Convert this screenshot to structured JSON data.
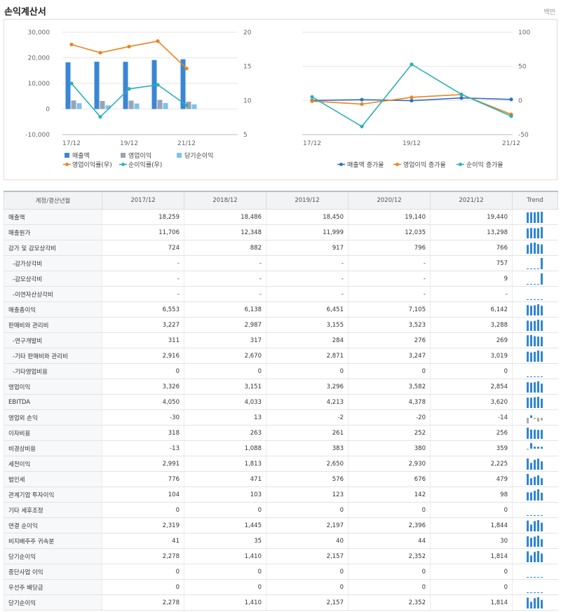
{
  "header": {
    "title": "손익계산서",
    "unit": "백만"
  },
  "colors": {
    "revenue": "#3a86d6",
    "op_income": "#9aa3b2",
    "net_income": "#7cc2f2",
    "op_margin": "#f0821d",
    "net_margin": "#2ab0b8",
    "rev_growth": "#2f6fc4",
    "op_growth": "#f0821d",
    "net_growth": "#2ab0b8",
    "trend_bar": "#2e86d6",
    "trend_neg": "#aaaaaa"
  },
  "chart_data": [
    {
      "type": "bar",
      "categories": [
        "17/12",
        "18/12",
        "19/12",
        "20/12",
        "21/12"
      ],
      "x_tick_labels": [
        "17/12",
        "19/12",
        "21/12"
      ],
      "left_axis": {
        "ylim": [
          -10000,
          30000
        ],
        "ticks": [
          "30,000",
          "20,000",
          "10,000",
          "0",
          "-10,000"
        ]
      },
      "right_axis": {
        "ylim": [
          5,
          20
        ],
        "ticks": [
          "20",
          "15",
          "10",
          "5"
        ]
      },
      "series": [
        {
          "name": "매출액",
          "type": "bar",
          "axis": "left",
          "values": [
            18259,
            18486,
            18450,
            19140,
            19440
          ]
        },
        {
          "name": "영업이익",
          "type": "bar",
          "axis": "left",
          "values": [
            3326,
            3151,
            3296,
            3582,
            2854
          ]
        },
        {
          "name": "당기순이익",
          "type": "bar",
          "axis": "left",
          "values": [
            2278,
            1410,
            2157,
            2352,
            1814
          ]
        },
        {
          "name": "영업이익률(우)",
          "type": "line",
          "axis": "right",
          "values": [
            18.2,
            17.0,
            17.9,
            18.7,
            14.7
          ]
        },
        {
          "name": "순이익률(우)",
          "type": "line",
          "axis": "right",
          "values": [
            12.5,
            7.6,
            11.7,
            12.3,
            9.3
          ]
        }
      ]
    },
    {
      "type": "line",
      "categories": [
        "17/12",
        "18/12",
        "19/12",
        "20/12",
        "21/12"
      ],
      "x_tick_labels": [
        "17/12",
        "19/12",
        "21/12"
      ],
      "right_axis": {
        "ylim": [
          -50,
          100
        ],
        "ticks": [
          "100",
          "50",
          "0",
          "-50"
        ]
      },
      "series": [
        {
          "name": "매출액 증가율",
          "values": [
            0.0,
            1.2,
            -0.2,
            3.7,
            1.6
          ]
        },
        {
          "name": "영업이익 증가율",
          "values": [
            -1.0,
            -5.3,
            4.6,
            8.7,
            -20.3
          ]
        },
        {
          "name": "순이익 증가율",
          "values": [
            5.3,
            -38.1,
            53.0,
            9.0,
            -22.9
          ]
        }
      ]
    }
  ],
  "table": {
    "headers": [
      "계정/결산년월",
      "2017/12",
      "2018/12",
      "2019/12",
      "2020/12",
      "2021/12",
      "Trend"
    ],
    "rows": [
      {
        "label": "매출액",
        "sub": false,
        "values": [
          "18,259",
          "18,486",
          "18,450",
          "19,140",
          "19,440"
        ]
      },
      {
        "label": "매출원가",
        "sub": false,
        "values": [
          "11,706",
          "12,348",
          "11,999",
          "12,035",
          "13,298"
        ]
      },
      {
        "label": "감가 및 감모상각비",
        "sub": false,
        "values": [
          "724",
          "882",
          "917",
          "796",
          "766"
        ]
      },
      {
        "label": "-감가상각비",
        "sub": true,
        "values": [
          "-",
          "-",
          "-",
          "-",
          "757"
        ]
      },
      {
        "label": "-감모상각비",
        "sub": true,
        "values": [
          "-",
          "-",
          "-",
          "-",
          "9"
        ]
      },
      {
        "label": "-이연자산상각비",
        "sub": true,
        "values": [
          "-",
          "-",
          "-",
          "-",
          "-"
        ]
      },
      {
        "label": "매출총이익",
        "sub": false,
        "values": [
          "6,553",
          "6,138",
          "6,451",
          "7,105",
          "6,142"
        ]
      },
      {
        "label": "판매비와 관리비",
        "sub": false,
        "values": [
          "3,227",
          "2,987",
          "3,155",
          "3,523",
          "3,288"
        ]
      },
      {
        "label": "-연구개발비",
        "sub": true,
        "values": [
          "311",
          "317",
          "284",
          "276",
          "269"
        ]
      },
      {
        "label": "-기타 판매비와 관리비",
        "sub": true,
        "values": [
          "2,916",
          "2,670",
          "2,871",
          "3,247",
          "3,019"
        ]
      },
      {
        "label": "-기타영업비용",
        "sub": true,
        "values": [
          "0",
          "0",
          "0",
          "0",
          "0"
        ]
      },
      {
        "label": "영업이익",
        "sub": false,
        "values": [
          "3,326",
          "3,151",
          "3,296",
          "3,582",
          "2,854"
        ]
      },
      {
        "label": "EBITDA",
        "sub": false,
        "values": [
          "4,050",
          "4,033",
          "4,213",
          "4,378",
          "3,620"
        ]
      },
      {
        "label": "영업외 손익",
        "sub": false,
        "values": [
          "-30",
          "13",
          "-2",
          "-20",
          "-14"
        ]
      },
      {
        "label": "이자비용",
        "sub": false,
        "values": [
          "318",
          "263",
          "261",
          "252",
          "256"
        ]
      },
      {
        "label": "비경상비용",
        "sub": false,
        "values": [
          "-13",
          "1,088",
          "383",
          "380",
          "359"
        ]
      },
      {
        "label": "세전이익",
        "sub": false,
        "values": [
          "2,991",
          "1,813",
          "2,650",
          "2,930",
          "2,225"
        ]
      },
      {
        "label": "법인세",
        "sub": false,
        "values": [
          "776",
          "471",
          "576",
          "676",
          "479"
        ]
      },
      {
        "label": "관계기업 투자이익",
        "sub": false,
        "values": [
          "104",
          "103",
          "123",
          "142",
          "98"
        ]
      },
      {
        "label": "기타 세후조정",
        "sub": false,
        "values": [
          "0",
          "0",
          "0",
          "0",
          "0"
        ]
      },
      {
        "label": "연결 순이익",
        "sub": false,
        "values": [
          "2,319",
          "1,445",
          "2,197",
          "2,396",
          "1,844"
        ]
      },
      {
        "label": "비지배주주 귀속분",
        "sub": false,
        "values": [
          "41",
          "35",
          "40",
          "44",
          "30"
        ]
      },
      {
        "label": "당기순이익",
        "sub": false,
        "values": [
          "2,278",
          "1,410",
          "2,157",
          "2,352",
          "1,814"
        ]
      },
      {
        "label": "중단사업 이익",
        "sub": false,
        "values": [
          "0",
          "0",
          "0",
          "0",
          "0"
        ]
      },
      {
        "label": "우선주 배당금",
        "sub": false,
        "values": [
          "0",
          "0",
          "0",
          "0",
          "0"
        ]
      },
      {
        "label": "당기순이익",
        "sub": false,
        "values": [
          "2,278",
          "1,410",
          "2,157",
          "2,352",
          "1,814"
        ]
      }
    ]
  }
}
